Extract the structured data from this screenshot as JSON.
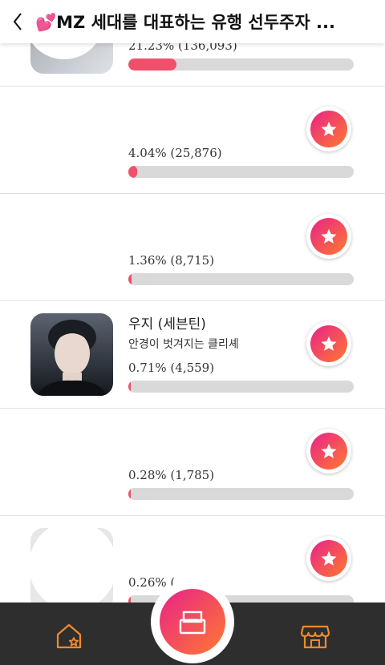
{
  "header": {
    "title": "💕MZ 세대를 대표하는 유행 선두주자 ..."
  },
  "rows": [
    {
      "name": "",
      "desc": "",
      "stat": "21.23% (136,093)",
      "percent": 21.23
    },
    {
      "name": "",
      "desc": "",
      "stat": "4.04% (25,876)",
      "percent": 4.04
    },
    {
      "name": "",
      "desc": "",
      "stat": "1.36% (8,715)",
      "percent": 1.36
    },
    {
      "name": "우지 (세븐틴)",
      "desc": "안경이 벗겨지는 클리셰",
      "stat": "0.71% (4,559)",
      "percent": 0.71
    },
    {
      "name": "",
      "desc": "",
      "stat": "0.28% (1,785)",
      "percent": 0.28
    },
    {
      "name": "",
      "desc": "",
      "stat": "0.26% (",
      "percent": 0.26
    }
  ],
  "icons": {
    "back": "chevron-left-icon",
    "vote": "star-icon",
    "home": "home-star-icon",
    "center": "ballot-box-icon",
    "shop": "store-icon"
  },
  "colors": {
    "accent_start": "#e8228a",
    "accent_end": "#ff7a2e",
    "bar_fill": "#f0506c",
    "bar_track": "#d9d9d9",
    "nav_bg": "#2e2e2e",
    "nav_icon": "#f08a2a"
  }
}
